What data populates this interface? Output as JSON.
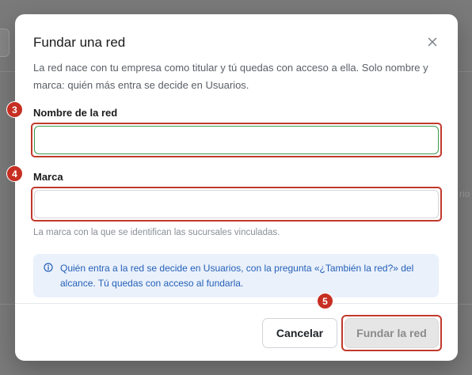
{
  "dialog": {
    "title": "Fundar una red",
    "description": "La red nace con tu empresa como titular y tú quedas con acceso a ella. Solo nombre y marca: quién más entra se decide en Usuarios.",
    "close_icon": "close-icon"
  },
  "fields": {
    "name": {
      "label": "Nombre de la red",
      "value": "",
      "placeholder": ""
    },
    "brand": {
      "label": "Marca",
      "value": "",
      "placeholder": "",
      "hint": "La marca con la que se identifican las sucursales vinculadas."
    }
  },
  "info": {
    "icon": "info-icon",
    "text": "Quién entra a la red se decide en Usuarios, con la pregunta «¿También la red?» del alcance. Tú quedas con acceso al fundarla."
  },
  "actions": {
    "cancel_label": "Cancelar",
    "submit_label": "Fundar la red"
  },
  "annotations": {
    "badge_name": "3",
    "badge_brand": "4",
    "badge_submit": "5"
  },
  "background": {
    "fragment_text": "rio"
  },
  "colors": {
    "annotation_red": "#c0392b",
    "focus_green": "#3a9a4e",
    "info_blue": "#2560b8",
    "info_bg": "#eaf1fb"
  }
}
